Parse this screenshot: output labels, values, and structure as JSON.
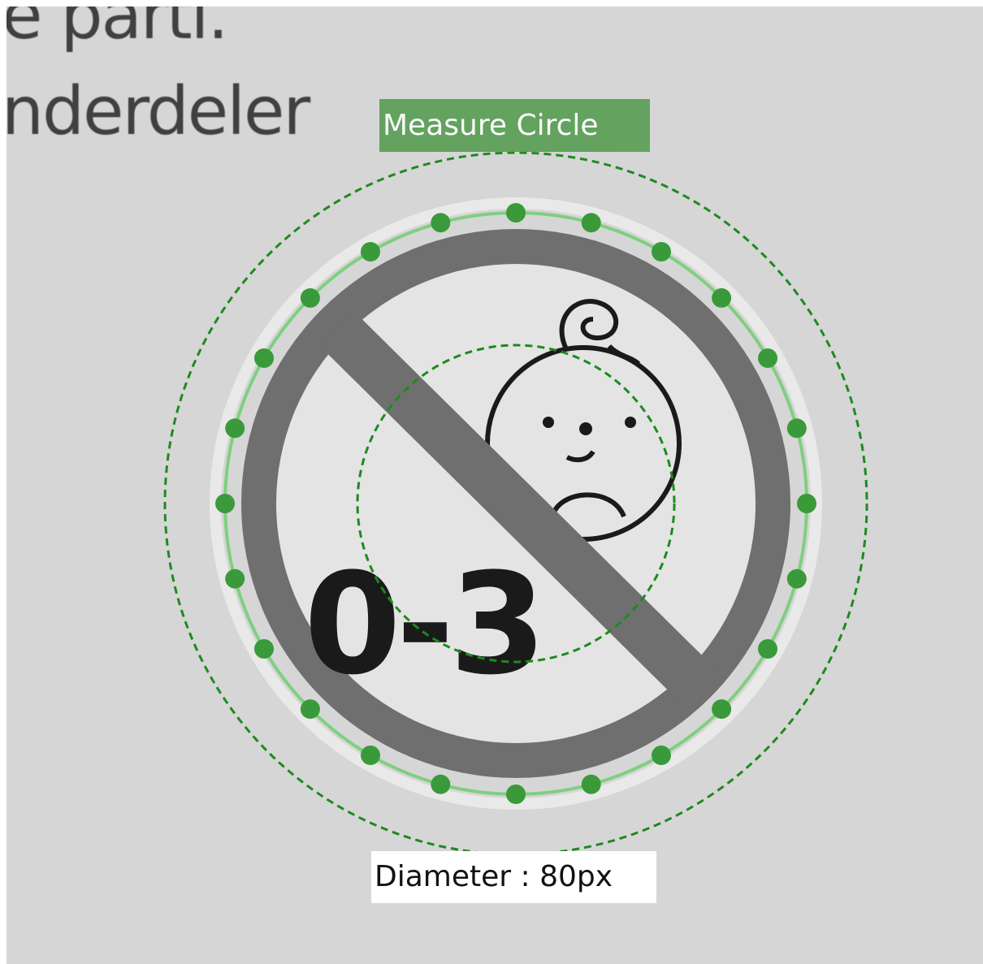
{
  "background": {
    "text_lines": [
      "e parti.",
      "nderdeler"
    ]
  },
  "sign": {
    "age_text": "0-3",
    "colors": {
      "ring": "#6f6f6f",
      "inner": "#e4e4e4",
      "ink": "#1a1a1a"
    }
  },
  "measure_tool": {
    "label": "Measure Circle",
    "result_label": "Diameter : 80px",
    "handle_count": 24,
    "colors": {
      "accent": "#3a9a3a",
      "dashed": "#1e8a1e",
      "fit_circle": "#7fcf7f",
      "label_bg": "#5a9e55"
    }
  }
}
